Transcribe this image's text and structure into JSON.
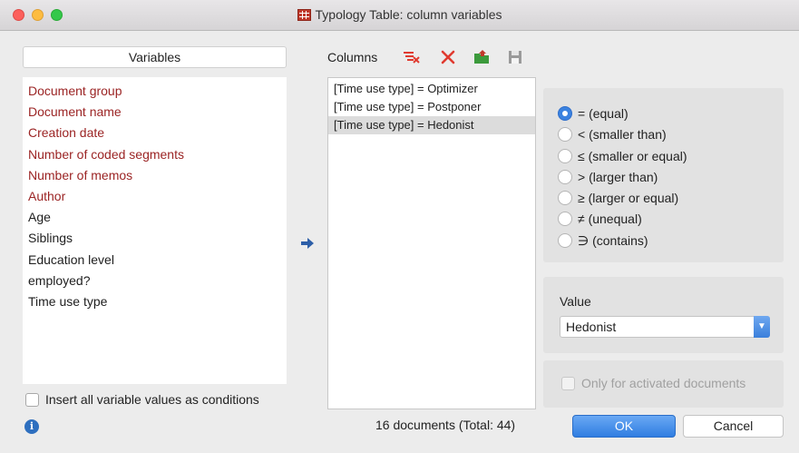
{
  "window": {
    "title": "Typology Table: column variables"
  },
  "variables": {
    "header": "Variables",
    "items": [
      {
        "label": "Document group",
        "kind": "system"
      },
      {
        "label": "Document name",
        "kind": "system"
      },
      {
        "label": "Creation date",
        "kind": "system"
      },
      {
        "label": "Number of coded segments",
        "kind": "system"
      },
      {
        "label": "Number of memos",
        "kind": "system"
      },
      {
        "label": "Author",
        "kind": "system"
      },
      {
        "label": "Age",
        "kind": "user"
      },
      {
        "label": "Siblings",
        "kind": "user"
      },
      {
        "label": "Education level",
        "kind": "user"
      },
      {
        "label": "employed?",
        "kind": "user"
      },
      {
        "label": "Time use type",
        "kind": "user"
      }
    ],
    "insert_all_label": "Insert all variable values as conditions",
    "insert_all_checked": false
  },
  "columns": {
    "label": "Columns",
    "toolbar_icons": [
      "filter-clear-icon",
      "delete-icon",
      "open-folder-icon",
      "save-icon"
    ],
    "items": [
      {
        "label": "[Time use type] = Optimizer",
        "selected": false
      },
      {
        "label": "[Time use type] = Postponer",
        "selected": false
      },
      {
        "label": "[Time use type] = Hedonist",
        "selected": true
      }
    ],
    "documents_count": "16 documents (Total: 44)"
  },
  "operators": {
    "options": [
      {
        "label": "= (equal)",
        "checked": true
      },
      {
        "label": "< (smaller than)",
        "checked": false
      },
      {
        "label": "≤ (smaller or equal)",
        "checked": false
      },
      {
        "label": "> (larger than)",
        "checked": false
      },
      {
        "label": "≥ (larger or equal)",
        "checked": false
      },
      {
        "label": "≠ (unequal)",
        "checked": false
      },
      {
        "label": "∋ (contains)",
        "checked": false
      }
    ]
  },
  "value": {
    "label": "Value",
    "selected": "Hedonist"
  },
  "activated_only": {
    "label": "Only for activated documents",
    "checked": false,
    "enabled": false
  },
  "buttons": {
    "ok": "OK",
    "cancel": "Cancel"
  },
  "colors": {
    "system_variable": "#9b2424",
    "accent": "#3b82e0",
    "toolbar_red": "#e03a2f",
    "toolbar_green": "#3c9a3c"
  }
}
